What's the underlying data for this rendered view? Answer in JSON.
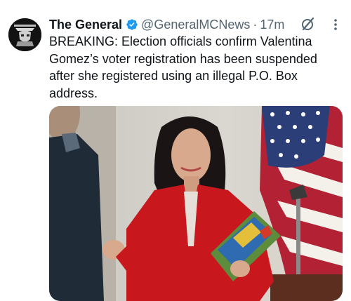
{
  "tweet": {
    "display_name": "The General",
    "handle": "@GeneralMCNews",
    "separator": "·",
    "timestamp": "17m",
    "text": "BREAKING: Election officials confirm Valentina Gomez’s voter registration has been suspended after she registered using an illegal P.O. Box address.",
    "verified_color": "#1d9bf0"
  },
  "icons": {
    "verified": "verified-badge-icon",
    "grok": "grok-icon",
    "more": "more-options-icon"
  }
}
